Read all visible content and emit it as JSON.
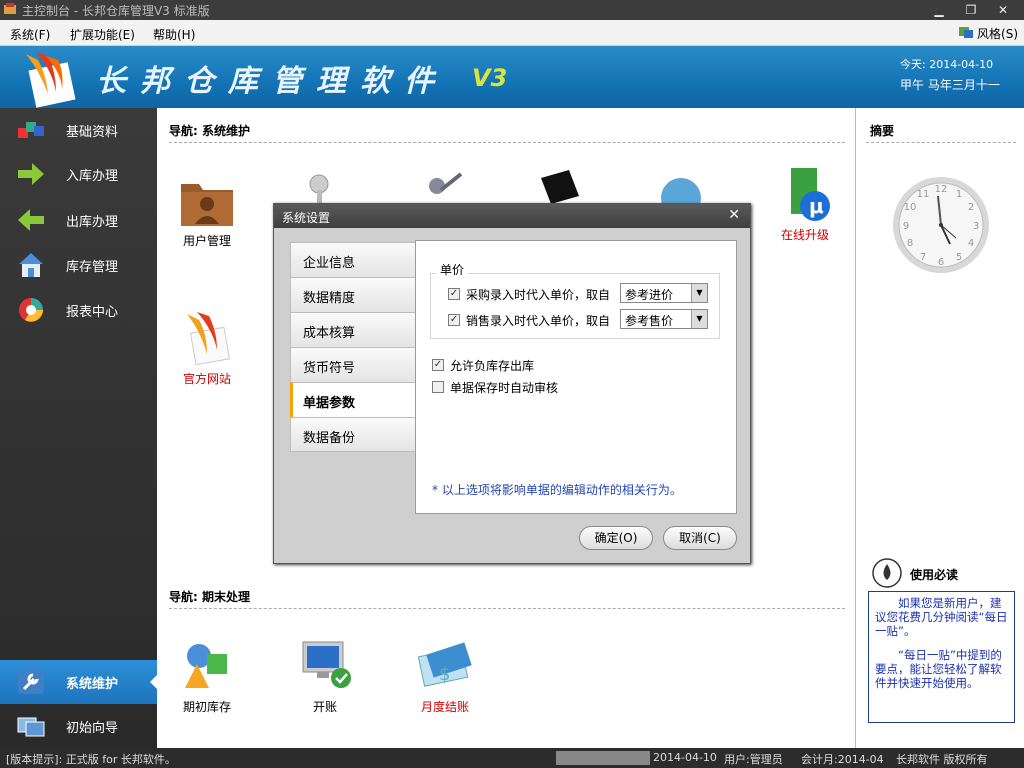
{
  "window": {
    "title": "主控制台 - 长邦仓库管理V3 标准版",
    "min": "▁",
    "max": "❐",
    "close": "✕"
  },
  "menu": {
    "items": [
      "系统(F)",
      "扩展功能(E)",
      "帮助(H)"
    ],
    "style_label": "风格(S)"
  },
  "banner": {
    "app_title": "长邦仓库管理软件",
    "version": "V3",
    "date": "今天: 2014-04-10",
    "lunar": "甲午 马年三月十一"
  },
  "sidebar": {
    "items": [
      {
        "label": "基础资料"
      },
      {
        "label": "入库办理"
      },
      {
        "label": "出库办理"
      },
      {
        "label": "库存管理"
      },
      {
        "label": "报表中心"
      }
    ],
    "bottom": [
      {
        "label": "系统维护"
      },
      {
        "label": "初始向导"
      }
    ]
  },
  "main": {
    "nav1_title": "导航: 系统维护",
    "nav1_tiles": [
      {
        "label": "用户管理"
      },
      {
        "label": "在线升级"
      },
      {
        "label": "官方网站"
      }
    ],
    "nav2_title": "导航: 期末处理",
    "nav2_tiles": [
      {
        "label": "期初库存"
      },
      {
        "label": "开账"
      },
      {
        "label": "月度结账"
      }
    ]
  },
  "right": {
    "summary_title": "摘要",
    "tips_title": "使用必读",
    "tips_p1": "如果您是新用户，建议您花费几分钟阅读“每日一贴”。",
    "tips_p2": "“每日一贴”中提到的要点，能让您轻松了解软件并快速开始使用。"
  },
  "dialog": {
    "title": "系统设置",
    "tabs": [
      "企业信息",
      "数据精度",
      "成本核算",
      "货币符号",
      "单据参数",
      "数据备份"
    ],
    "active_tab": "单据参数",
    "group_title": "单价",
    "purchase_label": "采购录入时代入单价，取自",
    "purchase_value": "参考进价",
    "sales_label": "销售录入时代入单价，取自",
    "sales_value": "参考售价",
    "allow_negative": "允许负库存出库",
    "auto_audit": "单据保存时自动审核",
    "note": "* 以上选项将影响单据的编辑动作的相关行为。",
    "ok": "确定(O)",
    "cancel": "取消(C)"
  },
  "status": {
    "hint": "[版本提示]: 正式版 for 长邦软件。",
    "date": "2014-04-10",
    "user": "用户:管理员",
    "period": "会计月:2014-04",
    "copyright": "长邦软件 版权所有"
  }
}
